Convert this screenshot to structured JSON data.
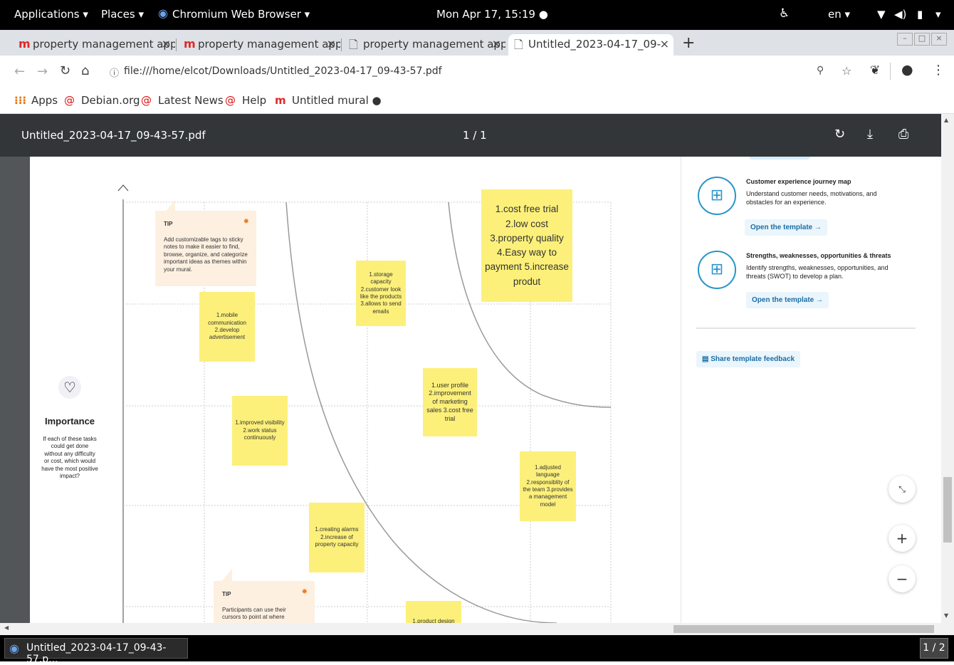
{
  "topbar": {
    "applications": "Applications ▾",
    "places": "Places ▾",
    "browser": "Chromium Web Browser ▾",
    "clock": "Mon Apr 17, 15:19 ●",
    "lang": "en ▾"
  },
  "tabs": [
    {
      "label": "property management appl"
    },
    {
      "label": "property management appl"
    },
    {
      "label": "property management appl"
    },
    {
      "label": "Untitled_2023-04-17_09-"
    }
  ],
  "toolbar": {
    "url": "file:///home/elcot/Downloads/Untitled_2023-04-17_09-43-57.pdf"
  },
  "bookmarks": [
    "Apps",
    "Debian.org",
    "Latest News",
    "Help",
    "Untitled mural ●"
  ],
  "pdf": {
    "title": "Untitled_2023-04-17_09-43-57.pdf",
    "page_counter": "1 / 1"
  },
  "mural": {
    "importance_title": "Importance",
    "importance_desc": "If each of these tasks could get done without any difficulty or cost, which would have the most positive impact?",
    "tip1_title": "TIP",
    "tip1_body": "Add customizable tags to sticky notes to make it easier to find, browse, organize, and categorize important ideas as themes within your mural.",
    "tip2_title": "TIP",
    "tip2_body": "Participants can use their cursors to point at where",
    "notes": [
      "1.cost free trial 2.low cost 3.property quality 4.Easy way to payment 5.increase produt",
      "1.storage capacity 2.customer look like the products 3.allows to send emails",
      "1.mobile communication 2.develop advertisement",
      "1.user profile 2.improvement of marketing sales 3.cost free trial",
      "1.improved visibility 2.work status continuously",
      "1.adjusted language 2.responsiblity of the team 3.provides a management model",
      "1.creating alarms 2.increase of property capacity",
      "1.product design"
    ]
  },
  "sidebar": {
    "cjm_title": "Customer experience journey map",
    "cjm_desc": "Understand customer needs, motivations, and obstacles for an experience.",
    "cjm_btn": "Open the template →",
    "swot_title": "Strengths, weaknesses, opportunities & threats",
    "swot_desc": "Identify strengths, weaknesses, opportunities, and threats (SWOT) to develop a plan.",
    "swot_btn": "Open the template →",
    "feedback": "Share template feedback"
  },
  "taskbar": {
    "window": "Untitled_2023-04-17_09-43-57.p...",
    "workspace": "1 / 2"
  }
}
